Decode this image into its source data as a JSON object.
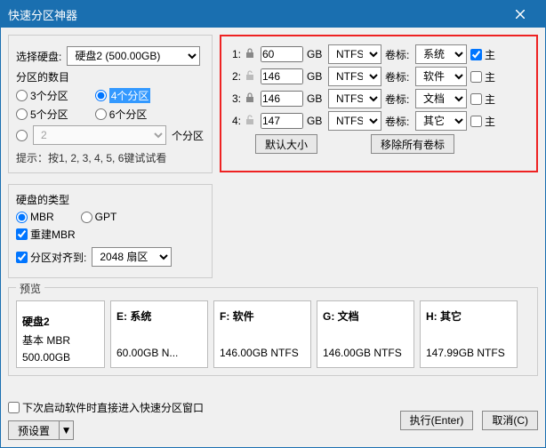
{
  "title": "快速分区神器",
  "left": {
    "selDiskLabel": "选择硬盘:",
    "selDiskValue": "硬盘2 (500.00GB)",
    "countLabel": "分区的数目",
    "r3": "3个分区",
    "r4": "4个分区",
    "r5": "5个分区",
    "r6": "6个分区",
    "customCount": "2",
    "customSuffix": "个分区",
    "hint": "提示：按1, 2, 3, 4, 5, 6键试试看"
  },
  "partitions": [
    {
      "n": "1:",
      "locked": true,
      "size": "60",
      "unit": "GB",
      "fs": "NTFS",
      "ll": "卷标:",
      "label": "系统",
      "primary": true
    },
    {
      "n": "2:",
      "locked": false,
      "size": "146",
      "unit": "GB",
      "fs": "NTFS",
      "ll": "卷标:",
      "label": "软件",
      "primary": false
    },
    {
      "n": "3:",
      "locked": true,
      "size": "146",
      "unit": "GB",
      "fs": "NTFS",
      "ll": "卷标:",
      "label": "文档",
      "primary": false
    },
    {
      "n": "4:",
      "locked": false,
      "size": "147",
      "unit": "GB",
      "fs": "NTFS",
      "ll": "卷标:",
      "label": "其它",
      "primary": false
    }
  ],
  "btnDefault": "默认大小",
  "btnClearLabels": "移除所有卷标",
  "primarySuffix": "主",
  "type": {
    "legend": "硬盘的类型",
    "mbr": "MBR",
    "gpt": "GPT",
    "rebuild": "重建MBR",
    "align": "分区对齐到:",
    "alignVal": "2048 扇区"
  },
  "preview": {
    "legend": "预览",
    "disk": {
      "name": "硬盘2",
      "sub": "基本 MBR",
      "size": "500.00GB"
    },
    "parts": [
      {
        "t": "E: 系统",
        "s": "60.00GB N..."
      },
      {
        "t": "F: 软件",
        "s": "146.00GB NTFS"
      },
      {
        "t": "G: 文档",
        "s": "146.00GB NTFS"
      },
      {
        "t": "H: 其它",
        "s": "147.99GB NTFS"
      }
    ]
  },
  "footer": {
    "nextTime": "下次启动软件时直接进入快速分区窗口",
    "preset": "预设置",
    "exec": "执行(Enter)",
    "cancel": "取消(C)"
  }
}
